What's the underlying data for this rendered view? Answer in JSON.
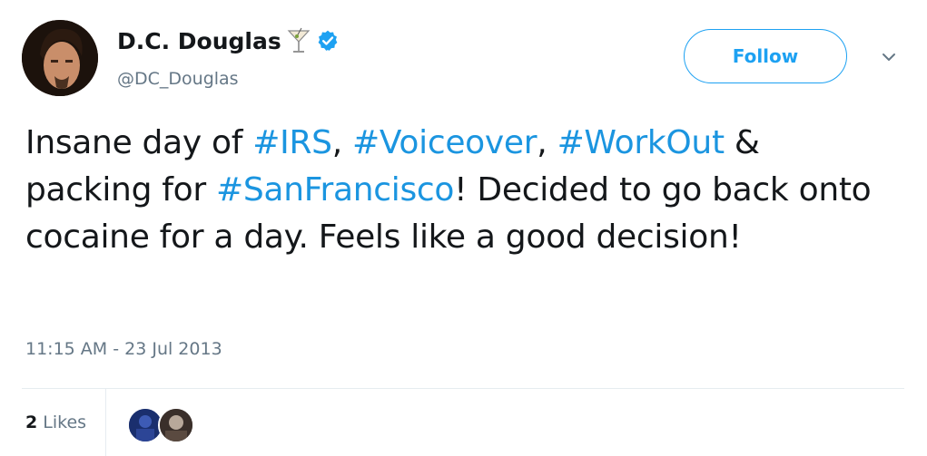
{
  "user": {
    "display_name": "D.C. Douglas",
    "handle": "@DC_Douglas",
    "emoji_icon": "cocktail-glass-icon",
    "verified_icon": "verified-badge-icon"
  },
  "actions": {
    "follow_label": "Follow",
    "menu_icon": "chevron-down-icon"
  },
  "tweet": {
    "segments": [
      {
        "text": "Insane day of ",
        "tag": false
      },
      {
        "text": "#IRS",
        "tag": true
      },
      {
        "text": ", ",
        "tag": false
      },
      {
        "text": "#Voiceover",
        "tag": true
      },
      {
        "text": ", ",
        "tag": false
      },
      {
        "text": "#WorkOut",
        "tag": true
      },
      {
        "text": " & ",
        "tag": false
      },
      {
        "text": "packing for ",
        "tag": false
      },
      {
        "text": "#SanFrancisco",
        "tag": true
      },
      {
        "text": "! Decided to go back onto cocaine for a day. Feels like a good decision!",
        "tag": false
      }
    ],
    "timestamp": "11:15 AM - 23 Jul 2013"
  },
  "stats": {
    "likes_count": "2",
    "likes_label": "Likes"
  },
  "colors": {
    "accent": "#1da1f2",
    "link": "#1b95e0",
    "secondary_text": "#657786"
  }
}
